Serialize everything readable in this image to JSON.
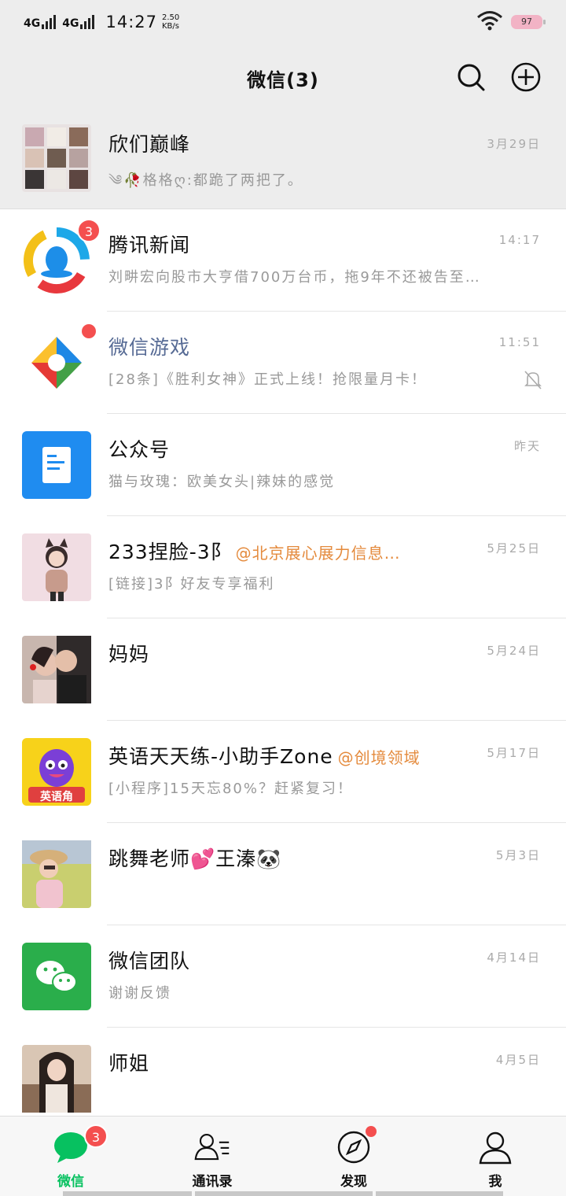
{
  "status_bar": {
    "sim1": "4G",
    "sim2": "4G",
    "time": "14:27",
    "speed_value": "2.50",
    "speed_unit": "KB/s",
    "battery": "97"
  },
  "header": {
    "title": "微信(3)"
  },
  "chats": [
    {
      "name": "欣们巅峰",
      "time": "3月29日",
      "preview": "༄🥀格格ღ:都跪了两把了。"
    },
    {
      "name": "腾讯新闻",
      "time": "14:17",
      "preview": "刘畊宏向股市大亨借700万台币，拖9年不还被告至…",
      "badge": "3"
    },
    {
      "name": "微信游戏",
      "time": "11:51",
      "preview": "[28条]《胜利女神》正式上线！抢限量月卡！"
    },
    {
      "name": "公众号",
      "time": "昨天",
      "preview": "猫与玫瑰：欧美女头|辣妹的感觉"
    },
    {
      "name": "233捏脸-3阝",
      "at": "@北京展心展力信息…",
      "time": "5月25日",
      "preview": "[链接]3阝好友专享福利"
    },
    {
      "name": "妈妈",
      "time": "5月24日",
      "preview": ""
    },
    {
      "name": "英语天天练-小助手Zone",
      "at": "@创境领域",
      "time": "5月17日",
      "preview": "[小程序]15天忘80%？赶紧复习！",
      "avatar_text": "英语角"
    },
    {
      "name": "跳舞老师💕王溱🐼",
      "time": "5月3日",
      "preview": ""
    },
    {
      "name": "微信团队",
      "time": "4月14日",
      "preview": "谢谢反馈"
    },
    {
      "name": "师姐",
      "time": "4月5日",
      "preview": ""
    }
  ],
  "tabs": [
    {
      "label": "微信",
      "badge": "3",
      "icon": "chat-icon"
    },
    {
      "label": "通讯录",
      "icon": "contacts-icon"
    },
    {
      "label": "发现",
      "icon": "compass-icon"
    },
    {
      "label": "我",
      "icon": "person-icon"
    }
  ],
  "colors": {
    "accent": "#07c160",
    "badge": "#f44f4f",
    "link_blue": "#576b95",
    "mention_orange": "#e48a3c"
  }
}
